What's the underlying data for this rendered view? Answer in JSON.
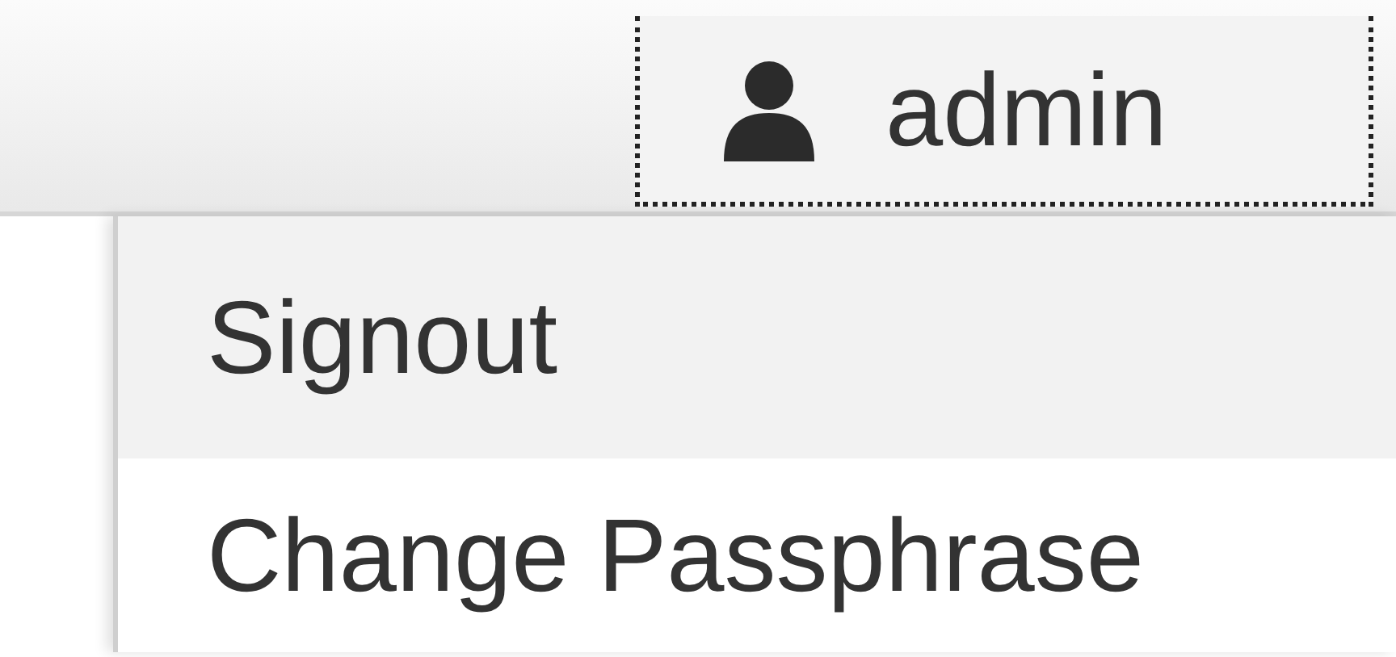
{
  "user_button": {
    "label": "admin"
  },
  "menu": {
    "items": [
      {
        "label": "Signout",
        "selected": true
      },
      {
        "label": "Change Passphrase",
        "selected": false
      }
    ]
  }
}
